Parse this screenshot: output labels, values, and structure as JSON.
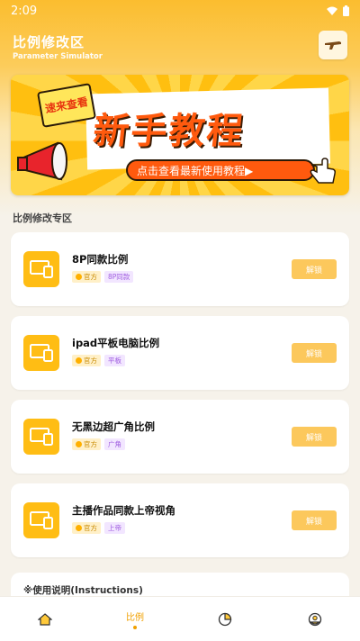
{
  "status": {
    "time": "2:09"
  },
  "header": {
    "title": "比例修改区",
    "subtitle": "Parameter Simulator"
  },
  "banner": {
    "tag": "速来查看",
    "headline": "新手教程",
    "cta": "点击查看最新使用教程▶"
  },
  "section": {
    "title": "比例修改专区"
  },
  "cards": [
    {
      "name": "8P同款比例",
      "tag_official": "官方",
      "tag_extra": "8P同款",
      "button": "解锁"
    },
    {
      "name": "ipad平板电脑比例",
      "tag_official": "官方",
      "tag_extra": "平板",
      "button": "解锁"
    },
    {
      "name": "无黑边超广角比例",
      "tag_official": "官方",
      "tag_extra": "广角",
      "button": "解锁"
    },
    {
      "name": "主播作品同款上帝视角",
      "tag_official": "官方",
      "tag_extra": "上帝",
      "button": "解锁"
    }
  ],
  "instructions": {
    "title": "※使用说明(Instructions)"
  },
  "nav": {
    "active_label": "比例"
  },
  "colors": {
    "accent": "#ffbd14",
    "button": "#fcc85c",
    "banner_orange": "#ff5a0e"
  },
  "icons": {
    "settings": "gun-icon",
    "card": "devices-icon",
    "nav": [
      "home-icon",
      "ratio-icon",
      "pie-icon",
      "profile-icon"
    ]
  }
}
